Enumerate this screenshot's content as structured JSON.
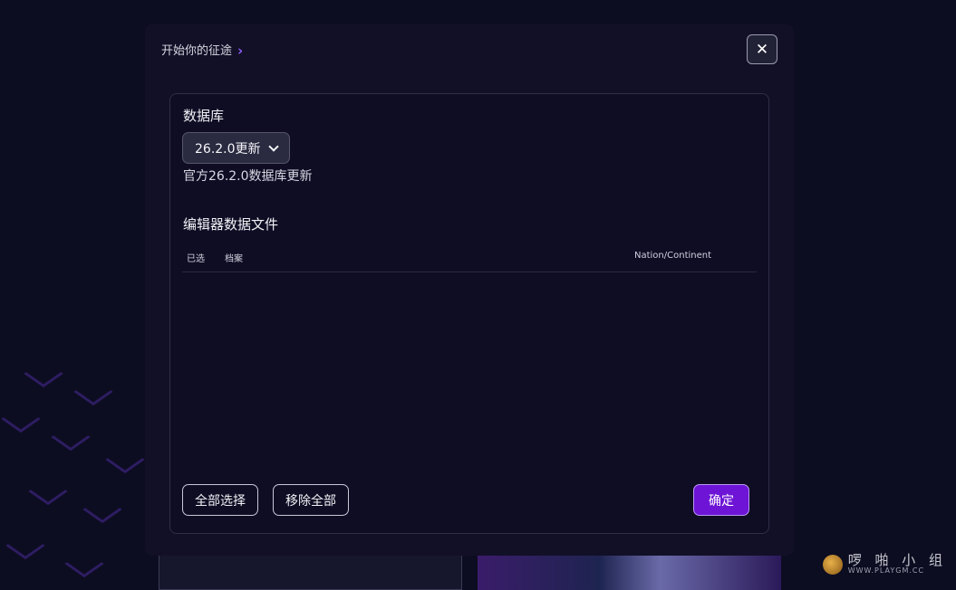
{
  "header": {
    "breadcrumb": "开始你的征途",
    "breadcrumb_arrow": "›"
  },
  "close_button": {
    "glyph": "✕"
  },
  "database": {
    "label": "数据库",
    "selected_version": "26.2.0更新",
    "description": "官方26.2.0数据库更新"
  },
  "editor_files": {
    "label": "编辑器数据文件",
    "columns": {
      "selected": "已选",
      "file": "档案",
      "nation": "Nation/Continent"
    },
    "rows": []
  },
  "buttons": {
    "select_all": "全部选择",
    "remove_all": "移除全部",
    "confirm": "确定"
  },
  "watermark": {
    "title": "啰 啪 小 组",
    "url": "WWW.PLAYGM.CC"
  },
  "colors": {
    "accent": "#6d14d6",
    "accent_border": "#b89af0",
    "breadcrumb_arrow": "#8b5cf6"
  }
}
